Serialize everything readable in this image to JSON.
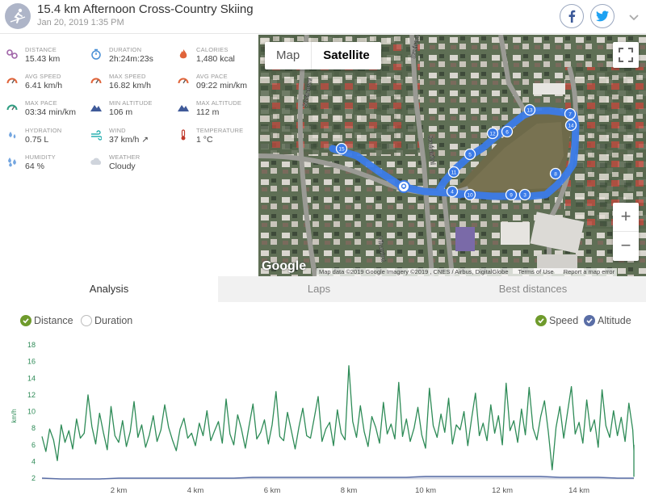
{
  "header": {
    "title": "15.4 km Afternoon Cross-Country Skiing",
    "date": "Jan 20, 2019 1:35 PM"
  },
  "stats": [
    {
      "label": "DISTANCE",
      "value": "15.43 km",
      "icon": "distance-icon",
      "color": "#a064a8"
    },
    {
      "label": "DURATION",
      "value": "2h:24m:23s",
      "icon": "stopwatch-icon",
      "color": "#4a90d6"
    },
    {
      "label": "CALORIES",
      "value": "1,480 kcal",
      "icon": "flame-icon",
      "color": "#e0643a"
    },
    {
      "label": "AVG SPEED",
      "value": "6.41 km/h",
      "icon": "speedometer-icon",
      "color": "#e0643a"
    },
    {
      "label": "MAX SPEED",
      "value": "16.82 km/h",
      "icon": "speedometer-icon",
      "color": "#e0643a"
    },
    {
      "label": "AVG PACE",
      "value": "09:22 min/km",
      "icon": "speedometer-icon",
      "color": "#e0643a"
    },
    {
      "label": "MAX PACE",
      "value": "03:34 min/km",
      "icon": "speedometer-icon",
      "color": "#2e9e82"
    },
    {
      "label": "MIN ALTITUDE",
      "value": "106 m",
      "icon": "mountain-icon",
      "color": "#3f5a99"
    },
    {
      "label": "MAX ALTITUDE",
      "value": "112 m",
      "icon": "mountain-icon",
      "color": "#3f5a99"
    },
    {
      "label": "HYDRATION",
      "value": "0.75 L",
      "icon": "water-drops-icon",
      "color": "#74a6e0"
    },
    {
      "label": "WIND",
      "value": "37 km/h ↗",
      "icon": "wind-icon",
      "color": "#2ab0b0"
    },
    {
      "label": "TEMPERATURE",
      "value": "1 °C",
      "icon": "thermometer-icon",
      "color": "#c0392b"
    },
    {
      "label": "HUMIDITY",
      "value": "64 %",
      "icon": "humidity-icon",
      "color": "#74a6e0"
    },
    {
      "label": "WEATHER",
      "value": "Cloudy",
      "icon": "cloud-icon",
      "color": "#cfd4dc"
    }
  ],
  "map": {
    "type_map": "Map",
    "type_satellite": "Satellite",
    "zoom_in": "+",
    "zoom_out": "−",
    "logo": "Google",
    "attribution": "Map data ©2019 Google Imagery ©2019 , CNES / Airbus, DigitalGlobe",
    "terms": "Terms of Use",
    "report": "Report a map error",
    "street_labels": [
      "Smárarimi",
      "Smárarimi",
      "Smárarimi",
      "Víkurrimi"
    ],
    "route_color": "#3b7be8",
    "markers": [
      "1",
      "2",
      "3",
      "4",
      "5",
      "6",
      "7",
      "8",
      "9",
      "10",
      "11",
      "12",
      "13",
      "14",
      "15"
    ]
  },
  "tabs": [
    "Analysis",
    "Laps",
    "Best distances"
  ],
  "legend": {
    "distance": "Distance",
    "duration": "Duration",
    "speed": "Speed",
    "altitude": "Altitude",
    "speed_color": "#2e8b57",
    "altitude_color": "#5a6ea6"
  },
  "chart_data": {
    "type": "line",
    "ylabel": "km/h",
    "xlabel": "",
    "ylim": [
      2,
      18
    ],
    "xlim": [
      0,
      15.43
    ],
    "yticks": [
      "2",
      "4",
      "6",
      "8",
      "10",
      "12",
      "14",
      "16",
      "18"
    ],
    "xticks": [
      "2 km",
      "4 km",
      "6 km",
      "8 km",
      "10 km",
      "12 km",
      "14 km"
    ],
    "xtick_values": [
      2,
      4,
      6,
      8,
      10,
      12,
      14
    ],
    "series": [
      {
        "name": "Speed",
        "x_step_km": 0.1,
        "values": [
          7.0,
          5.2,
          7.9,
          6.6,
          4.1,
          8.4,
          6.3,
          7.7,
          5.5,
          9.1,
          6.8,
          7.4,
          12.0,
          8.2,
          6.1,
          9.8,
          7.5,
          5.4,
          10.6,
          7.1,
          6.3,
          8.9,
          5.8,
          7.6,
          11.2,
          6.9,
          8.4,
          5.7,
          7.2,
          9.5,
          6.4,
          7.8,
          10.8,
          8.1,
          6.6,
          5.3,
          7.9,
          9.2,
          6.8,
          7.4,
          5.9,
          8.6,
          7.1,
          10.1,
          6.5,
          7.7,
          8.8,
          6.2,
          11.5,
          7.3,
          6.0,
          9.6,
          7.9,
          5.6,
          8.3,
          10.9,
          6.7,
          7.5,
          9.0,
          6.1,
          8.4,
          12.4,
          7.0,
          6.5,
          9.9,
          7.7,
          5.5,
          8.2,
          10.4,
          7.1,
          6.8,
          9.3,
          11.8,
          6.4,
          7.9,
          8.7,
          5.9,
          10.2,
          7.4,
          6.6,
          15.5,
          8.8,
          6.9,
          10.7,
          7.6,
          5.8,
          9.4,
          8.1,
          6.2,
          11.1,
          7.3,
          8.5,
          6.7,
          13.5,
          7.0,
          9.1,
          6.4,
          8.0,
          10.5,
          7.2,
          5.6,
          12.8,
          8.3,
          6.9,
          9.7,
          7.5,
          11.6,
          6.1,
          8.4,
          7.8,
          10.0,
          5.9,
          9.2,
          12.2,
          7.1,
          8.6,
          6.5,
          10.8,
          7.4,
          9.5,
          6.0,
          13.4,
          7.7,
          8.9,
          6.3,
          10.3,
          7.2,
          12.9,
          8.0,
          6.6,
          9.4,
          11.3,
          7.5,
          3.0,
          8.1,
          10.6,
          6.8,
          9.9,
          13.0,
          7.3,
          8.7,
          6.2,
          11.4,
          7.6,
          9.0,
          5.7,
          12.6,
          8.3,
          6.9,
          10.1,
          7.1,
          9.3,
          6.4,
          11.0,
          7.8,
          5.3,
          2.2,
          6.0
        ]
      },
      {
        "name": "Altitude",
        "x_step_km": 0.5,
        "values": [
          2.0,
          1.9,
          1.9,
          1.9,
          2.0,
          2.0,
          2.0,
          2.0,
          2.0,
          2.0,
          2.0,
          2.1,
          2.1,
          2.1,
          2.1,
          2.1,
          2.1,
          2.1,
          2.1,
          2.1,
          2.2,
          2.2,
          2.2,
          2.2,
          2.2,
          2.2,
          2.2,
          2.1,
          2.1,
          2.1,
          2.0,
          2.0
        ]
      }
    ]
  }
}
